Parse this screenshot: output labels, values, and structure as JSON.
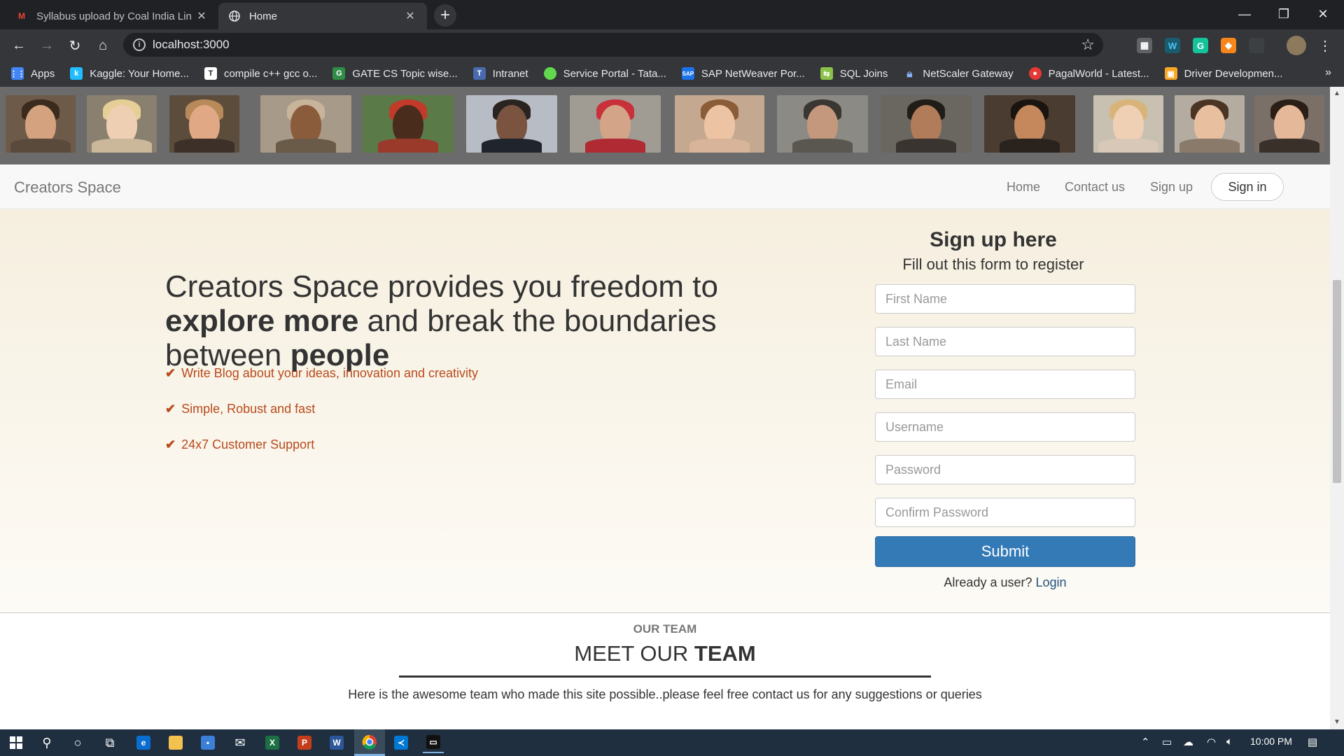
{
  "browser": {
    "tabs": [
      {
        "title": "Syllabus upload by Coal India Lin",
        "active": false,
        "icon": "gmail-icon"
      },
      {
        "title": "Home",
        "active": true,
        "icon": "globe-icon"
      }
    ],
    "url": "localhost:3000",
    "bookmarks": [
      {
        "label": "Apps",
        "icon": "apps-grid-icon",
        "color": "#4285f4"
      },
      {
        "label": "Kaggle: Your Home...",
        "icon": "kaggle-icon",
        "color": "#20beff"
      },
      {
        "label": "compile c++ gcc o...",
        "icon": "t-icon",
        "color": "#222222"
      },
      {
        "label": "GATE CS Topic wise...",
        "icon": "geeks-icon",
        "color": "#2f8d46"
      },
      {
        "label": "Intranet",
        "icon": "tata-icon",
        "color": "#486aae"
      },
      {
        "label": "Service Portal - Tata...",
        "icon": "portal-icon",
        "color": "#62d84e"
      },
      {
        "label": "SAP NetWeaver Por...",
        "icon": "sap-icon",
        "color": "#1a73e8"
      },
      {
        "label": "SQL Joins",
        "icon": "sql-icon",
        "color": "#8bc34a"
      },
      {
        "label": "NetScaler Gateway",
        "icon": "lock-icon",
        "color": "#8ab4f8"
      },
      {
        "label": "PagalWorld - Latest...",
        "icon": "pagalworld-icon",
        "color": "#e53935"
      },
      {
        "label": "Driver Developmen...",
        "icon": "driver-icon",
        "color": "#f9a825"
      }
    ],
    "more": "»"
  },
  "site": {
    "brand": "Creators Space",
    "nav": {
      "home": "Home",
      "contact": "Contact us",
      "signup": "Sign up",
      "signin": "Sign in"
    },
    "hero": {
      "line1": "Creators Space provides you freedom to",
      "line2_bold": "explore more",
      "line2_rest": " and break the boundaries",
      "line3_start": "between ",
      "line3_bold": "people",
      "features": [
        "Write Blog about your ideas, innovation and creativity",
        "Simple, Robust and fast",
        "24x7 Customer Support"
      ]
    },
    "form": {
      "title": "Sign up here",
      "subtitle": "Fill out this form to register",
      "first_name": "First Name",
      "last_name": "Last Name",
      "email": "Email",
      "username": "Username",
      "password": "Password",
      "confirm_password": "Confirm Password",
      "submit": "Submit",
      "already": "Already a user?",
      "login": "Login"
    },
    "team": {
      "eyebrow": "OUR TEAM",
      "title_start": "MEET OUR ",
      "title_bold": "TEAM",
      "description": "Here is the awesome team who made this site possible..please feel free contact us for any suggestions or queries"
    }
  },
  "taskbar": {
    "time": "10:00 PM"
  },
  "colors": {
    "accent": "#337ab7",
    "feature_text": "#b84a1c",
    "hero_bg_top": "#f6efdf"
  }
}
